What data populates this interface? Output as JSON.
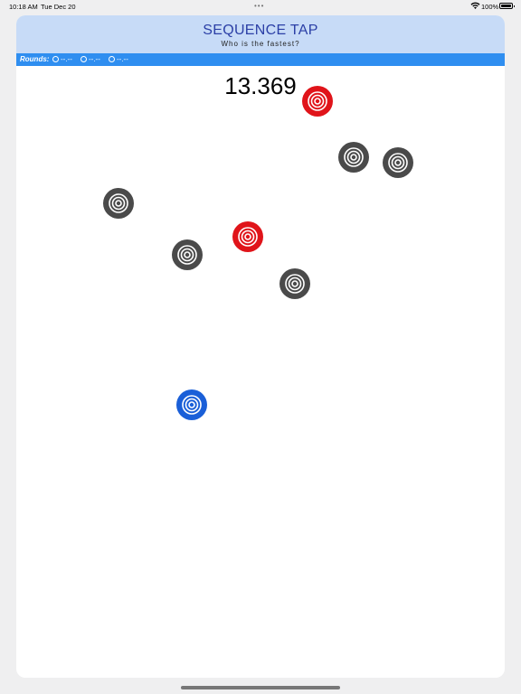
{
  "status_bar": {
    "time": "10:18 AM",
    "date": "Tue Dec 20",
    "dots": "•••",
    "battery": "100%"
  },
  "header": {
    "title": "SEQUENCE TAP",
    "subtitle": "Who is the fastest?",
    "color": "#c7dbf7"
  },
  "rounds": {
    "label": "Rounds:",
    "slots": [
      "--.--",
      "--.--",
      "--.--"
    ],
    "color": "#2f8ef0"
  },
  "timer": "13.369",
  "targets": [
    {
      "color": "red",
      "hex": "#e0141a"
    },
    {
      "color": "gray",
      "hex": "#4a4a4a"
    },
    {
      "color": "gray",
      "hex": "#4a4a4a"
    },
    {
      "color": "gray",
      "hex": "#4a4a4a"
    },
    {
      "color": "red",
      "hex": "#e0141a"
    },
    {
      "color": "gray",
      "hex": "#4a4a4a"
    },
    {
      "color": "gray",
      "hex": "#4a4a4a"
    },
    {
      "color": "blue",
      "hex": "#1a5fd8"
    }
  ],
  "icons": {
    "target": "bullseye-icon",
    "wifi": "wifi-icon",
    "battery": "battery-icon"
  }
}
